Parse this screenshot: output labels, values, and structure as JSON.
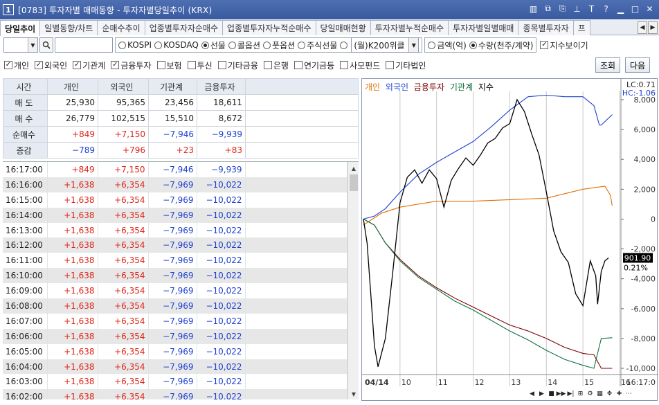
{
  "window": {
    "number": "1",
    "title": "[0783] 투자자별 매매동향 - 투자자별당일추이 (KRX)"
  },
  "tabs": [
    "당일추이",
    "일별동향/차트",
    "순매수추이",
    "업종별투자자순매수",
    "업종별투자자누적순매수",
    "당일매매현황",
    "투자자별누적순매수",
    "투자자별일별매매",
    "종목별투자자",
    "프"
  ],
  "toolbar": {
    "market_options": [
      "KOSPI",
      "KOSDAQ",
      "선물",
      "콜옵션",
      "풋옵션",
      "주식선물"
    ],
    "market_selected": "선물",
    "k200_value": "(월)K200위클",
    "unit_options": [
      "금액(억)",
      "수량(천주/계약)"
    ],
    "unit_selected": "수량(천주/계약)",
    "index_show_label": "지수보이기"
  },
  "filters": [
    {
      "label": "개인",
      "checked": true
    },
    {
      "label": "외국인",
      "checked": true
    },
    {
      "label": "기관계",
      "checked": true
    },
    {
      "label": "금융투자",
      "checked": true
    },
    {
      "label": "보험",
      "checked": false
    },
    {
      "label": "투신",
      "checked": false
    },
    {
      "label": "기타금융",
      "checked": false
    },
    {
      "label": "은행",
      "checked": false
    },
    {
      "label": "연기금등",
      "checked": false
    },
    {
      "label": "사모펀드",
      "checked": false
    },
    {
      "label": "기타법인",
      "checked": false
    }
  ],
  "buttons": {
    "query": "조회",
    "next": "다음"
  },
  "summary": {
    "headers": [
      "시간",
      "개인",
      "외국인",
      "기관계",
      "금융투자"
    ],
    "rows": [
      {
        "label": "매 도",
        "values": [
          "25,930",
          "95,365",
          "23,456",
          "18,611"
        ],
        "colors": [
          "",
          "",
          "",
          ""
        ]
      },
      {
        "label": "매 수",
        "values": [
          "26,779",
          "102,515",
          "15,510",
          "8,672"
        ],
        "colors": [
          "",
          "",
          "",
          ""
        ]
      },
      {
        "label": "순매수",
        "values": [
          "+849",
          "+7,150",
          "−7,946",
          "−9,939"
        ],
        "colors": [
          "red",
          "red",
          "blue",
          "blue"
        ]
      },
      {
        "label": "증감",
        "values": [
          "−789",
          "+796",
          "+23",
          "+83"
        ],
        "colors": [
          "blue",
          "red",
          "red",
          "red"
        ]
      }
    ]
  },
  "timeseries": [
    {
      "time": "16:17:00",
      "values": [
        "+849",
        "+7,150",
        "−7,946",
        "−9,939"
      ],
      "colors": [
        "red",
        "red",
        "blue",
        "blue"
      ]
    },
    {
      "time": "16:16:00",
      "values": [
        "+1,638",
        "+6,354",
        "−7,969",
        "−10,022"
      ],
      "colors": [
        "red",
        "red",
        "blue",
        "blue"
      ]
    },
    {
      "time": "16:15:00",
      "values": [
        "+1,638",
        "+6,354",
        "−7,969",
        "−10,022"
      ],
      "colors": [
        "red",
        "red",
        "blue",
        "blue"
      ]
    },
    {
      "time": "16:14:00",
      "values": [
        "+1,638",
        "+6,354",
        "−7,969",
        "−10,022"
      ],
      "colors": [
        "red",
        "red",
        "blue",
        "blue"
      ]
    },
    {
      "time": "16:13:00",
      "values": [
        "+1,638",
        "+6,354",
        "−7,969",
        "−10,022"
      ],
      "colors": [
        "red",
        "red",
        "blue",
        "blue"
      ]
    },
    {
      "time": "16:12:00",
      "values": [
        "+1,638",
        "+6,354",
        "−7,969",
        "−10,022"
      ],
      "colors": [
        "red",
        "red",
        "blue",
        "blue"
      ]
    },
    {
      "time": "16:11:00",
      "values": [
        "+1,638",
        "+6,354",
        "−7,969",
        "−10,022"
      ],
      "colors": [
        "red",
        "red",
        "blue",
        "blue"
      ]
    },
    {
      "time": "16:10:00",
      "values": [
        "+1,638",
        "+6,354",
        "−7,969",
        "−10,022"
      ],
      "colors": [
        "red",
        "red",
        "blue",
        "blue"
      ]
    },
    {
      "time": "16:09:00",
      "values": [
        "+1,638",
        "+6,354",
        "−7,969",
        "−10,022"
      ],
      "colors": [
        "red",
        "red",
        "blue",
        "blue"
      ]
    },
    {
      "time": "16:08:00",
      "values": [
        "+1,638",
        "+6,354",
        "−7,969",
        "−10,022"
      ],
      "colors": [
        "red",
        "red",
        "blue",
        "blue"
      ]
    },
    {
      "time": "16:07:00",
      "values": [
        "+1,638",
        "+6,354",
        "−7,969",
        "−10,022"
      ],
      "colors": [
        "red",
        "red",
        "blue",
        "blue"
      ]
    },
    {
      "time": "16:06:00",
      "values": [
        "+1,638",
        "+6,354",
        "−7,969",
        "−10,022"
      ],
      "colors": [
        "red",
        "red",
        "blue",
        "blue"
      ]
    },
    {
      "time": "16:05:00",
      "values": [
        "+1,638",
        "+6,354",
        "−7,969",
        "−10,022"
      ],
      "colors": [
        "red",
        "red",
        "blue",
        "blue"
      ]
    },
    {
      "time": "16:04:00",
      "values": [
        "+1,638",
        "+6,354",
        "−7,969",
        "−10,022"
      ],
      "colors": [
        "red",
        "red",
        "blue",
        "blue"
      ]
    },
    {
      "time": "16:03:00",
      "values": [
        "+1,638",
        "+6,354",
        "−7,969",
        "−10,022"
      ],
      "colors": [
        "red",
        "red",
        "blue",
        "blue"
      ]
    },
    {
      "time": "16:02:00",
      "values": [
        "+1,638",
        "+6,354",
        "−7,969",
        "−10,022"
      ],
      "colors": [
        "red",
        "red",
        "blue",
        "blue"
      ]
    }
  ],
  "chart_data": {
    "type": "line",
    "legend": [
      "개인",
      "외국인",
      "금융투자",
      "기관계",
      "지수"
    ],
    "colors": {
      "개인": "#e07000",
      "외국인": "#1c3fd0",
      "금융투자": "#7a0000",
      "기관계": "#107040",
      "지수": "#000000"
    },
    "x_labels": [
      "04/14",
      "10",
      "11",
      "12",
      "13",
      "14",
      "15",
      "16",
      "16:17:0"
    ],
    "y_ticks": [
      "8,000",
      "6,000",
      "4,000",
      "2,000",
      "0",
      "-2,000",
      "-4,000",
      "-6,000",
      "-8,000",
      "-10,000"
    ],
    "ylim": [
      -10000,
      8000
    ],
    "lc_label": "LC:0.71",
    "hc_label": "HC:-1.06",
    "index_value": "901.90",
    "index_change": "0.21%",
    "series": [
      {
        "name": "개인",
        "x": [
          9.0,
          9.5,
          10.0,
          11.0,
          12.0,
          13.0,
          14.0,
          15.0,
          15.6,
          15.75,
          15.8
        ],
        "values": [
          -400,
          400,
          800,
          1200,
          1200,
          1300,
          1400,
          2000,
          2200,
          1600,
          900
        ]
      },
      {
        "name": "외국인",
        "x": [
          9.0,
          9.3,
          9.6,
          10.0,
          10.5,
          11.0,
          11.5,
          12.0,
          12.5,
          13.0,
          13.5,
          14.0,
          14.5,
          15.0,
          15.3,
          15.45,
          15.5,
          15.8
        ],
        "values": [
          0,
          200,
          700,
          1800,
          3000,
          3800,
          4500,
          5200,
          6200,
          7300,
          8200,
          8300,
          8200,
          8200,
          7600,
          6300,
          6300,
          7000
        ]
      },
      {
        "name": "금융투자",
        "x": [
          9.0,
          9.3,
          9.6,
          10.0,
          10.5,
          11.0,
          11.5,
          12.0,
          12.5,
          13.0,
          13.5,
          14.0,
          14.5,
          15.0,
          15.3,
          15.5,
          15.8
        ],
        "values": [
          0,
          -400,
          -1600,
          -2700,
          -3800,
          -4600,
          -5300,
          -5900,
          -6500,
          -7100,
          -7500,
          -8000,
          -8600,
          -9000,
          -9100,
          -10000,
          -10000
        ]
      },
      {
        "name": "기관계",
        "x": [
          9.0,
          9.3,
          9.6,
          10.0,
          10.5,
          11.0,
          11.5,
          12.0,
          12.5,
          13.0,
          13.5,
          14.0,
          14.5,
          15.0,
          15.3,
          15.5,
          15.8
        ],
        "values": [
          0,
          -400,
          -1600,
          -2800,
          -3900,
          -4700,
          -5500,
          -6100,
          -6800,
          -7500,
          -8100,
          -8800,
          -9400,
          -9800,
          -10000,
          -8000,
          -7950
        ]
      },
      {
        "name": "지수",
        "x": [
          9.0,
          9.1,
          9.2,
          9.3,
          9.4,
          9.6,
          9.8,
          10.0,
          10.2,
          10.4,
          10.6,
          10.8,
          11.0,
          11.2,
          11.4,
          11.6,
          11.8,
          12.0,
          12.2,
          12.4,
          12.6,
          12.8,
          13.0,
          13.2,
          13.4,
          13.6,
          13.8,
          14.0,
          14.2,
          14.4,
          14.6,
          14.8,
          15.0,
          15.2,
          15.35,
          15.4,
          15.5,
          15.6,
          15.7
        ],
        "values": [
          0,
          -1600,
          -5000,
          -8500,
          -9900,
          -8000,
          -3600,
          1100,
          2800,
          3300,
          2400,
          3300,
          2700,
          800,
          2600,
          3400,
          4100,
          3600,
          4300,
          5100,
          5400,
          6100,
          6400,
          8000,
          7200,
          5700,
          4300,
          1800,
          -800,
          -2200,
          -2900,
          -5000,
          -5800,
          -2800,
          -3800,
          -5700,
          -3500,
          -2800,
          -2600
        ]
      }
    ]
  }
}
